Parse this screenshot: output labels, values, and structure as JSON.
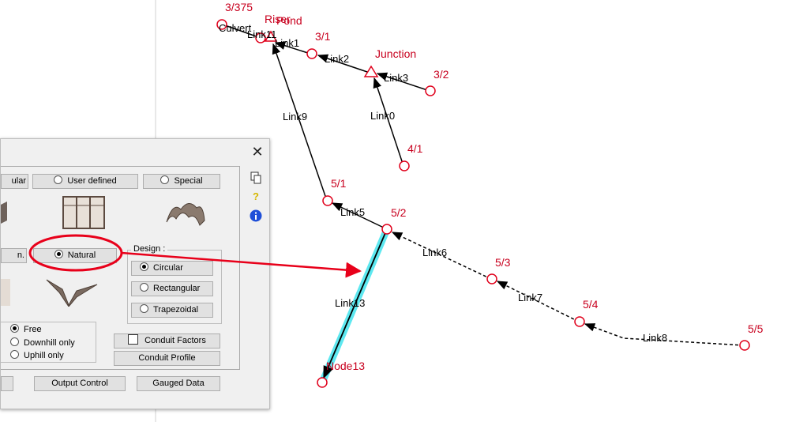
{
  "network": {
    "nodes": [
      {
        "label": "3/375"
      },
      {
        "label": "Culvert"
      },
      {
        "label": "Riser"
      },
      {
        "label": "Pond"
      },
      {
        "label": "3/1"
      },
      {
        "label": "Junction"
      },
      {
        "label": "3/2"
      },
      {
        "label": "4/1"
      },
      {
        "label": "5/1"
      },
      {
        "label": "5/2"
      },
      {
        "label": "5/3"
      },
      {
        "label": "5/4"
      },
      {
        "label": "5/5"
      },
      {
        "label": "Node13"
      }
    ],
    "links": [
      {
        "label": "Link11"
      },
      {
        "label": "Link1"
      },
      {
        "label": "Link2"
      },
      {
        "label": "Link3"
      },
      {
        "label": "Link0"
      },
      {
        "label": "Link9"
      },
      {
        "label": "Link5"
      },
      {
        "label": "Link6"
      },
      {
        "label": "Link7"
      },
      {
        "label": "Link8"
      },
      {
        "label": "Link13"
      }
    ],
    "colors": {
      "node": "#e0001b",
      "highlight": "#5ee8f0",
      "annotation": "#e8001a"
    }
  },
  "dialog": {
    "close_label": "✕",
    "top_buttons": {
      "circular_partial": "ular",
      "user_defined": "User defined",
      "special": "Special"
    },
    "natural_label": "Natural",
    "left_partial_label": "n.",
    "design": {
      "title": "Design :",
      "options": [
        "Circular",
        "Rectangular",
        "Trapezoidal"
      ],
      "selected": "Circular"
    },
    "flow_options": [
      "Free",
      "Downhill only",
      "Uphill only"
    ],
    "flow_selected": "Free",
    "conduit_factors_label": "Conduit Factors",
    "conduit_profile_label": "Conduit Profile",
    "output_control_label": "Output Control",
    "gauged_data_label": "Gauged Data",
    "icons": [
      "copy-icon",
      "help-icon",
      "info-icon"
    ]
  }
}
